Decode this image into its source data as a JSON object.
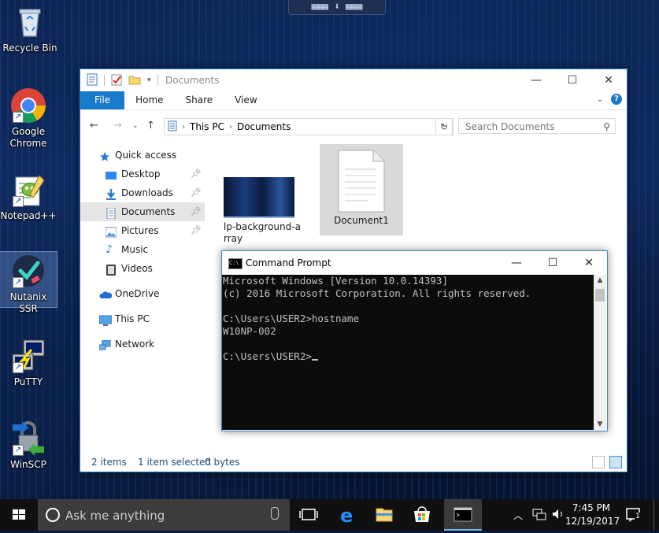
{
  "top_bar": {
    "glyph": "▦▦▦ ⬇ ▦▦▦"
  },
  "desktop": {
    "icons": [
      {
        "label": "Recycle Bin",
        "icon": "recycle-bin-icon"
      },
      {
        "label": "Google Chrome",
        "icon": "chrome-icon"
      },
      {
        "label": "Notepad++",
        "icon": "notepadpp-icon"
      },
      {
        "label": "Nutanix SSR",
        "icon": "nutanix-icon"
      },
      {
        "label": "PuTTY",
        "icon": "putty-icon"
      },
      {
        "label": "WinSCP",
        "icon": "winscp-icon"
      }
    ]
  },
  "explorer": {
    "title": "Documents",
    "ribbon": {
      "file": "File",
      "tabs": [
        "Home",
        "Share",
        "View"
      ]
    },
    "address": {
      "crumbs": [
        "This PC",
        "Documents"
      ],
      "search_placeholder": "Search Documents"
    },
    "nav": {
      "quick_access": "Quick access",
      "quick_items": [
        "Desktop",
        "Downloads",
        "Documents",
        "Pictures",
        "Music",
        "Videos"
      ],
      "onedrive": "OneDrive",
      "this_pc": "This PC",
      "network": "Network"
    },
    "files": [
      {
        "name": "lp-background-a\nrray",
        "name_line1": "lp-background-a",
        "name_line2": "rray"
      },
      {
        "name": "Document1"
      }
    ],
    "status": {
      "items": "2 items",
      "selected": "1 item selected",
      "size": "0 bytes"
    }
  },
  "cmd": {
    "title": "Command Prompt",
    "icon_text": "C:\\",
    "lines": [
      "Microsoft Windows [Version 10.0.14393]",
      "(c) 2016 Microsoft Corporation. All rights reserved.",
      "",
      "C:\\Users\\USER2>hostname",
      "W10NP-002",
      "",
      "C:\\Users\\USER2>"
    ]
  },
  "taskbar": {
    "search_placeholder": "Ask me anything",
    "time": "7:45 PM",
    "date": "12/19/2017",
    "notification_count": "1"
  },
  "colors": {
    "accent": "#1979ca",
    "taskbar": "#101010",
    "console_bg": "#0c0c0c",
    "console_fg": "#c0c0c0"
  }
}
